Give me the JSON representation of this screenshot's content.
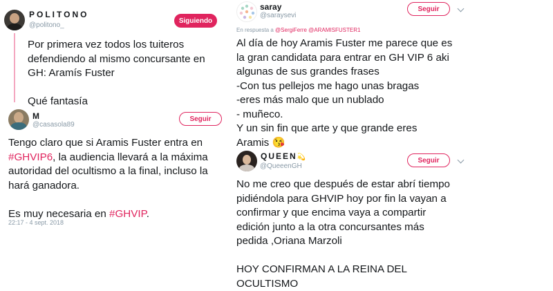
{
  "tweet1": {
    "name": "POLITONO",
    "handle": "@politono_",
    "button": "Siguiendo",
    "text": [
      "Por primera vez todos los tuiteros",
      "defendiendo al mismo concursante en",
      "GH: Aramís Fuster",
      "",
      "Qué fantasía"
    ]
  },
  "tweet2": {
    "name": "M",
    "handle": "@casasola89",
    "button": "Seguir",
    "line1": "Tengo claro que si Aramis Fuster entra en",
    "hashtag1": "#GHVIP6",
    "line2_rest": ", la audiencia llevará a la máxima",
    "line3": "autoridad del ocultismo a la final, incluso la",
    "line4": "hará ganadora.",
    "line5_pre": "Es muy necesaria en ",
    "hashtag2": "#GHVIP",
    "line5_post": ".",
    "timestamp": "22:17 - 4 sept. 2018"
  },
  "tweet3": {
    "name": "saray",
    "handle": "@saraysevi",
    "button": "Seguir",
    "reply_prefix": "En respuesta a ",
    "reply_users": "@SergiFerre @ARAMISFUSTER1",
    "text": [
      "Al día de hoy Aramis Fuster me parece que es",
      "la gran candidata para entrar en GH VIP 6 aki",
      "algunas de sus grandes frases",
      "-Con tus pellejos me hago unas bragas",
      "-eres más malo que un nublado",
      "- muñeco.",
      "Y un sin fin que arte y que grande eres"
    ],
    "last_line": "Aramis",
    "emoji": "😘"
  },
  "tweet4": {
    "name": "QUEEN",
    "name_emoji": "💫",
    "handle": "@QueeenGH",
    "button": "Seguir",
    "text": [
      "No me creo que después de estar abrí tiempo",
      "pidiéndola para GHVIP hoy por fin la vayan a",
      "confirmar y que encima vaya a compartir",
      "edición junto a la otra concursantes más",
      "pedida ,Oriana Marzoli",
      "",
      "HOY CONFIRMAN A LA REINA DEL",
      "OCULTISMO"
    ]
  },
  "colors": {
    "accent": "#e0245e",
    "secondary_text": "#8899a6",
    "thread_line": "#f4a7c0"
  }
}
